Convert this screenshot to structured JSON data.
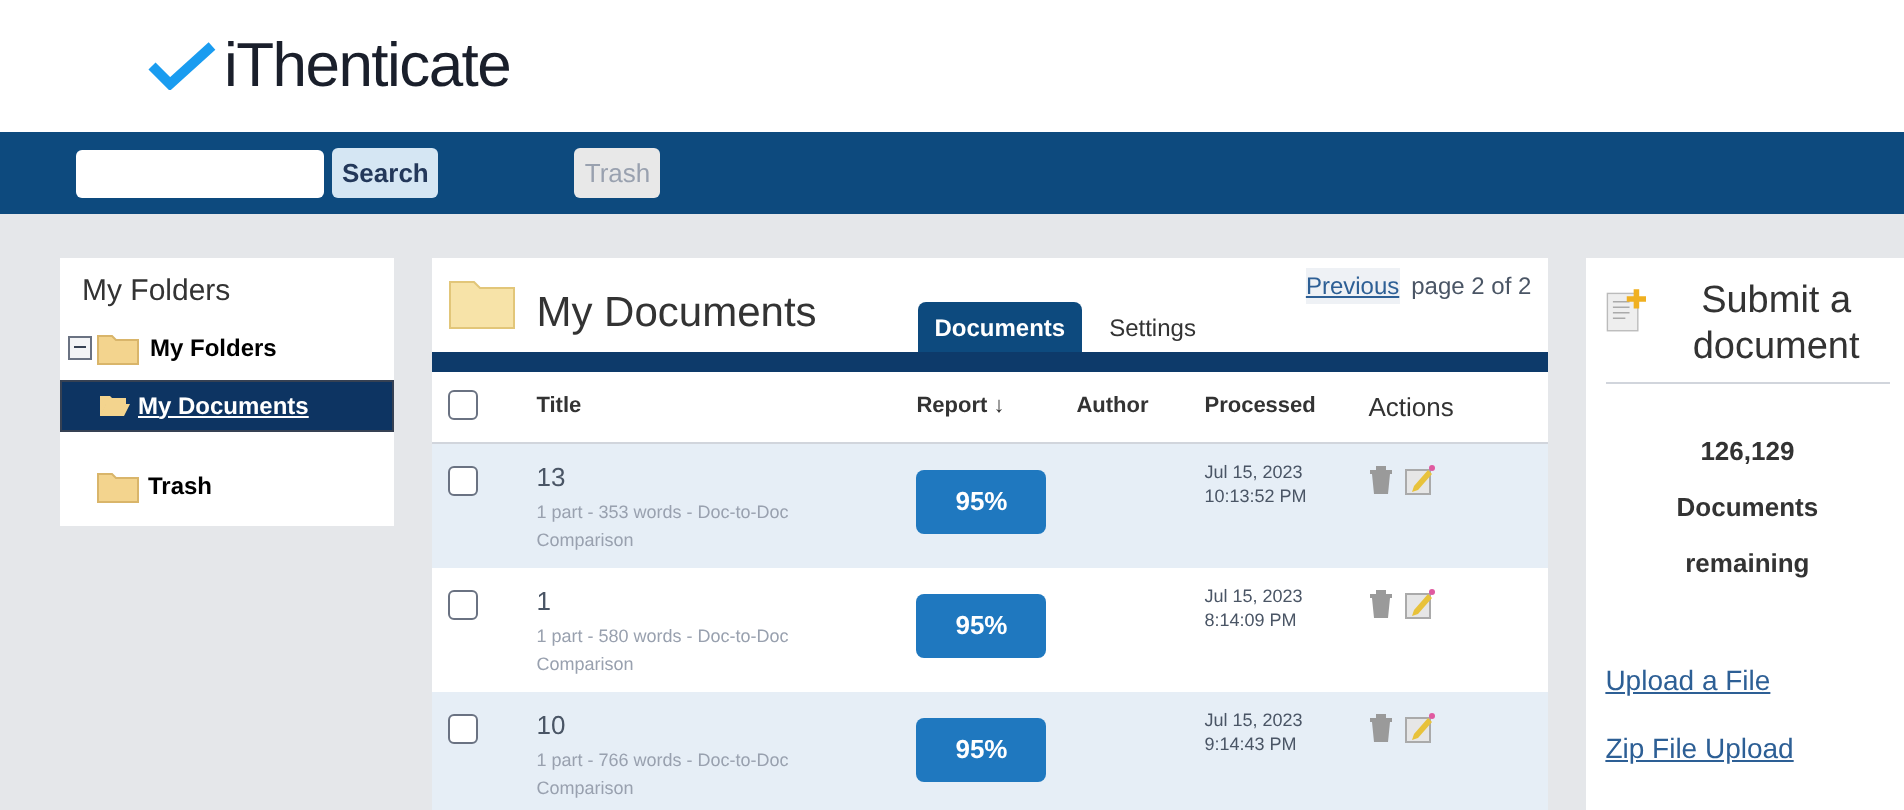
{
  "logo": {
    "text": "iThenticate"
  },
  "toolbar": {
    "search_button": "Search",
    "trash_button": "Trash"
  },
  "sidebar": {
    "title": "My Folders",
    "tree": {
      "label": "My Folders",
      "expanded": true,
      "children": [
        {
          "label": "My Documents",
          "selected": true
        },
        {
          "label": "Trash",
          "selected": false
        }
      ]
    }
  },
  "main": {
    "title": "My Documents",
    "pager": {
      "previous": "Previous",
      "page": "page 2 of 2"
    },
    "tabs": [
      {
        "label": "Documents",
        "selected": true
      },
      {
        "label": "Settings",
        "selected": false
      }
    ],
    "table": {
      "select_all_checked": false,
      "columns": [
        "Title",
        "Report ↓",
        "Author",
        "Processed",
        "Actions"
      ],
      "rows": [
        {
          "checked": false,
          "title": "13",
          "meta": "1 part - 353 words - Doc-to-Doc Comparison",
          "report": "95%",
          "date": "Jul 15, 2023",
          "time": "10:13:52 PM"
        },
        {
          "checked": false,
          "title": "1",
          "meta": "1 part - 580 words - Doc-to-Doc Comparison",
          "report": "95%",
          "date": "Jul 15, 2023",
          "time": "8:14:09 PM"
        },
        {
          "checked": false,
          "title": "10",
          "meta": "1 part - 766 words - Doc-to-Doc Comparison",
          "report": "95%",
          "date": "Jul 15, 2023",
          "time": "9:14:43 PM"
        }
      ]
    }
  },
  "submit_panel": {
    "title": "Submit a document",
    "count": "126,129",
    "count_label_1": "Documents",
    "count_label_2": "remaining",
    "links": [
      "Upload a File",
      "Zip File Upload"
    ]
  }
}
